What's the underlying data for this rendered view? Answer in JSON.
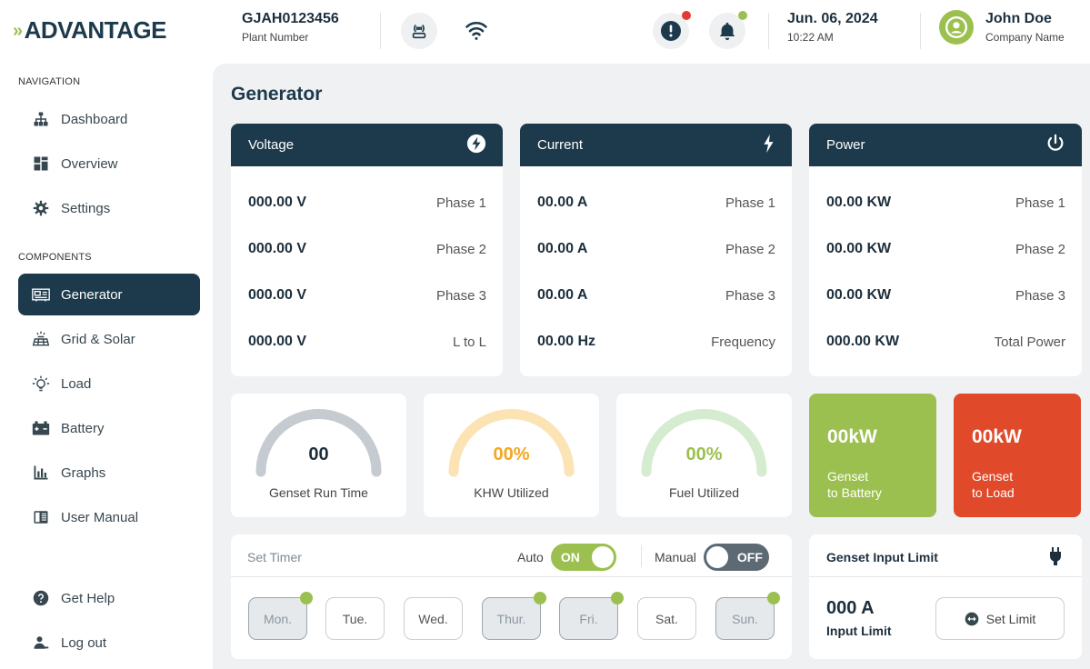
{
  "header": {
    "logo": "ADVANTAGE",
    "plant_number": "GJAH0123456",
    "plant_label": "Plant Number",
    "date": "Jun. 06, 2024",
    "time": "10:22 AM",
    "user_name": "John Doe",
    "company": "Company Name",
    "icons": [
      "antenna-icon",
      "wifi-icon",
      "alert-icon",
      "bell-icon",
      "user-icon"
    ],
    "badge_colors": {
      "alert": "#e53935",
      "bell": "#9cc04f"
    }
  },
  "sidebar": {
    "nav_section": "NAVIGATION",
    "nav_items": [
      {
        "label": "Dashboard",
        "icon": "sitemap-icon"
      },
      {
        "label": "Overview",
        "icon": "grid-icon"
      },
      {
        "label": "Settings",
        "icon": "gear-icon"
      }
    ],
    "components_section": "COMPONENTS",
    "component_items": [
      {
        "label": "Generator",
        "icon": "generator-icon",
        "active": true
      },
      {
        "label": "Grid & Solar",
        "icon": "solar-icon"
      },
      {
        "label": "Load",
        "icon": "bulb-icon"
      },
      {
        "label": "Battery",
        "icon": "battery-icon"
      },
      {
        "label": "Graphs",
        "icon": "bar-chart-icon"
      },
      {
        "label": "User Manual",
        "icon": "book-icon"
      }
    ],
    "bottom_items": [
      {
        "label": "Get Help",
        "icon": "help-icon"
      },
      {
        "label": "Log out",
        "icon": "logout-icon"
      }
    ]
  },
  "main": {
    "title": "Generator",
    "voltage": {
      "title": "Voltage",
      "icon": "bolt-circle-icon",
      "rows": [
        {
          "value": "000.00 V",
          "label": "Phase 1"
        },
        {
          "value": "000.00 V",
          "label": "Phase 2"
        },
        {
          "value": "000.00 V",
          "label": "Phase 3"
        },
        {
          "value": "000.00 V",
          "label": "L to L"
        }
      ]
    },
    "current": {
      "title": "Current",
      "icon": "bolt-icon",
      "rows": [
        {
          "value": "00.00 A",
          "label": "Phase 1"
        },
        {
          "value": "00.00 A",
          "label": "Phase 2"
        },
        {
          "value": "00.00 A",
          "label": "Phase 3"
        },
        {
          "value": "00.00 Hz",
          "label": "Frequency"
        }
      ]
    },
    "power": {
      "title": "Power",
      "icon": "power-icon",
      "rows": [
        {
          "value": "00.00 KW",
          "label": "Phase 1"
        },
        {
          "value": "00.00 KW",
          "label": "Phase 2"
        },
        {
          "value": "00.00 KW",
          "label": "Phase 3"
        },
        {
          "value": "000.00 KW",
          "label": "Total Power"
        }
      ]
    },
    "gauges": [
      {
        "value": "00",
        "label": "Genset Run Time",
        "color": "#c5cbd0",
        "text_color": "#1d2f3d"
      },
      {
        "value": "00%",
        "label": "KHW Utilized",
        "color": "#fbe3b4",
        "text_color": "#f5a623"
      },
      {
        "value": "00%",
        "label": "Fuel Utilized",
        "color": "#d6ecd0",
        "text_color": "#9cc04f"
      }
    ],
    "tiles": [
      {
        "value": "00kW",
        "line1": "Genset",
        "line2": "to Battery",
        "color": "#9cc04f"
      },
      {
        "value": "00kW",
        "line1": "Genset",
        "line2": "to Load",
        "color": "#e04a2b"
      }
    ],
    "timer": {
      "title": "Set Timer",
      "auto_label": "Auto",
      "auto_state": "ON",
      "manual_label": "Manual",
      "manual_state": "OFF",
      "days": [
        {
          "label": "Mon.",
          "selected": true
        },
        {
          "label": "Tue.",
          "selected": false
        },
        {
          "label": "Wed.",
          "selected": false
        },
        {
          "label": "Thur.",
          "selected": true
        },
        {
          "label": "Fri.",
          "selected": true
        },
        {
          "label": "Sat.",
          "selected": false
        },
        {
          "label": "Sun.",
          "selected": true
        }
      ]
    },
    "limit": {
      "title": "Genset Input Limit",
      "value": "000 A",
      "label": "Input Limit",
      "button": "Set Limit",
      "icon": "plug-icon"
    }
  }
}
